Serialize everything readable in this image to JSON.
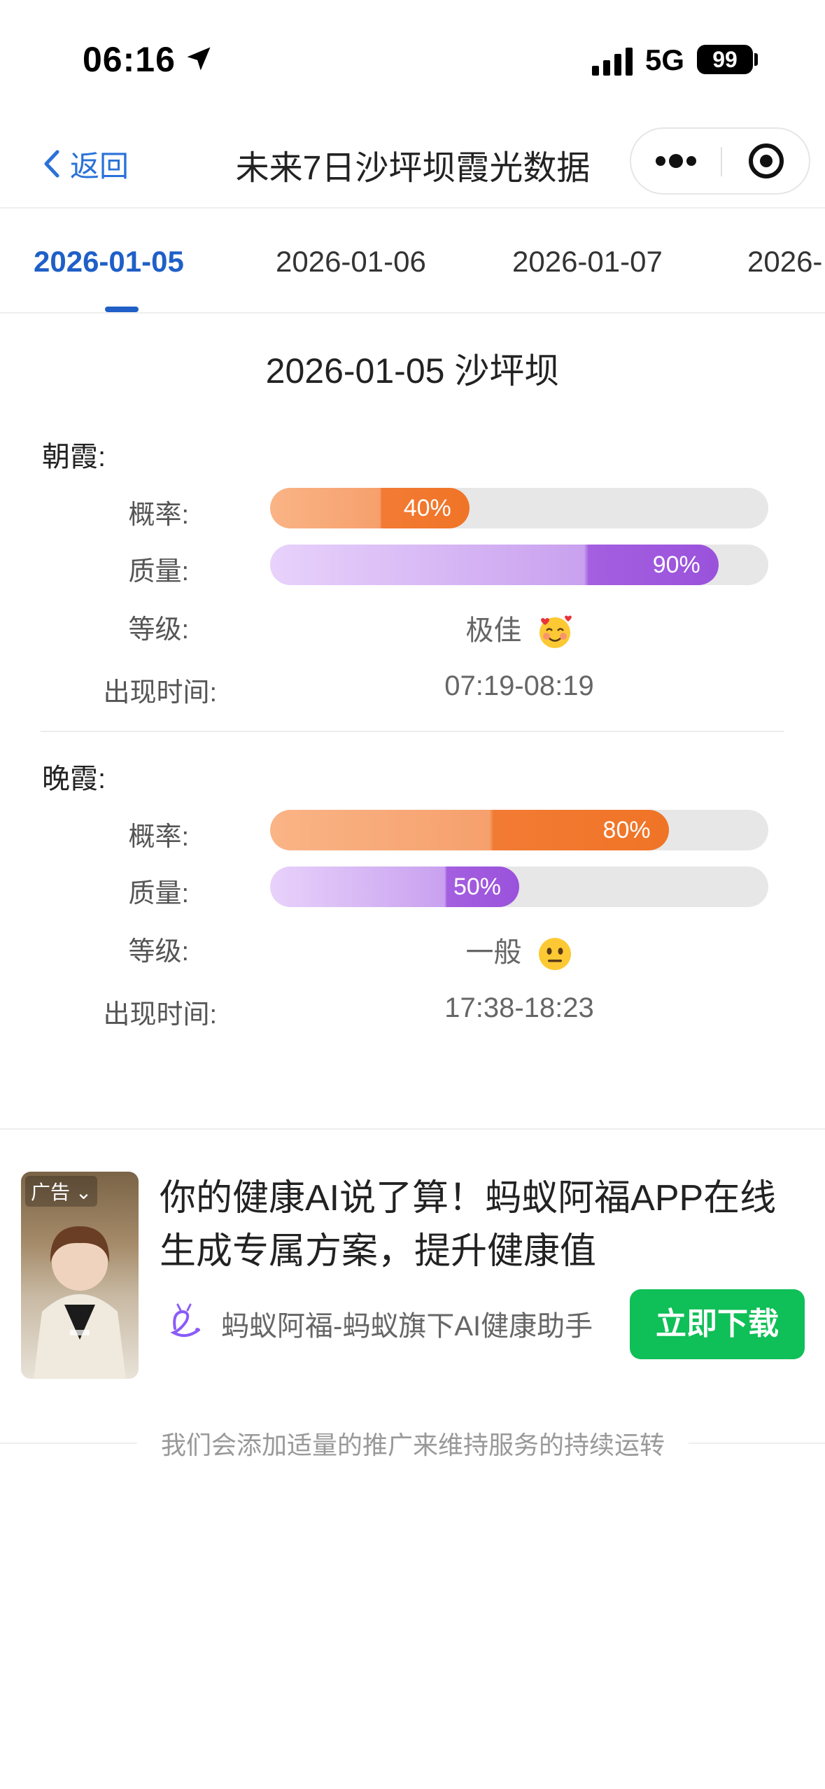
{
  "status_bar": {
    "time": "06:16",
    "network": "5G",
    "battery": "99"
  },
  "nav": {
    "back_label": "返回",
    "title": "未来7日沙坪坝霞光数据"
  },
  "tabs": [
    "2026-01-05",
    "2026-01-06",
    "2026-01-07",
    "2026-"
  ],
  "active_tab": 0,
  "day_title": "2026-01-05 沙坪坝",
  "labels": {
    "probability": "概率:",
    "quality": "质量:",
    "grade": "等级:",
    "time": "出现时间:"
  },
  "morning": {
    "label": "朝霞:",
    "probability": 40,
    "probability_text": "40%",
    "quality": 90,
    "quality_text": "90%",
    "grade": "极佳",
    "grade_icon": "smiling-face-with-hearts-icon",
    "time": "07:19-08:19"
  },
  "evening": {
    "label": "晚霞:",
    "probability": 80,
    "probability_text": "80%",
    "quality": 50,
    "quality_text": "50%",
    "grade": "一般",
    "grade_icon": "neutral-face-icon",
    "time": "17:38-18:23"
  },
  "ad": {
    "badge": "广告",
    "headline_line1": "你的健康AI说了算！蚂蚁阿福APP在线",
    "headline_line2": "生成专属方案，提升健康值",
    "brand": "蚂蚁阿福-蚂蚁旗下AI健康助手",
    "cta": "立即下载"
  },
  "footer_note": "我们会添加适量的推广来维持服务的持续运转",
  "colors": {
    "accent_blue": "#1f5fc7",
    "probability_bar": "#f07426",
    "quality_bar": "#9a52db",
    "cta_green": "#0fbf57"
  }
}
